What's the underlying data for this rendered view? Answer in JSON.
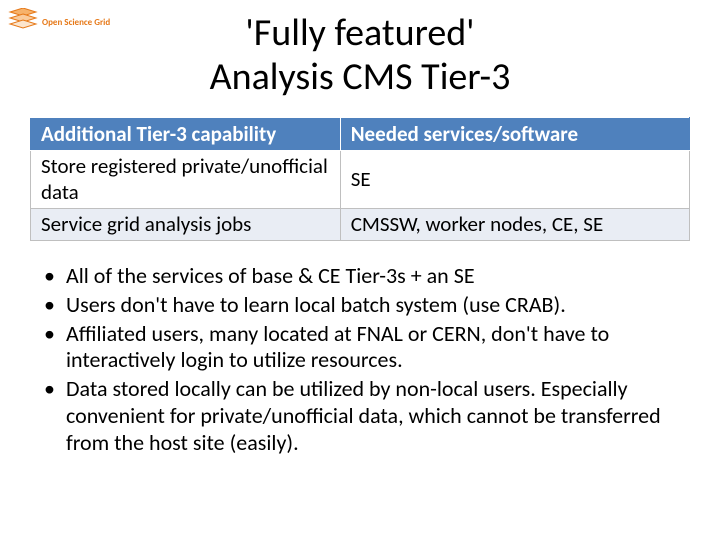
{
  "logo": {
    "text": "Open Science Grid"
  },
  "title": {
    "line1": "'Fully featured'",
    "line2": "Analysis CMS Tier-3"
  },
  "table": {
    "headers": [
      "Additional Tier-3 capability",
      "Needed services/software"
    ],
    "rows": [
      {
        "c1": "Store registered private/unofficial data",
        "c2": "SE"
      },
      {
        "c1": "Service grid analysis jobs",
        "c2": "CMSSW, worker nodes, CE, SE"
      }
    ]
  },
  "bullets": [
    "All of the services of base & CE Tier-3s + an SE",
    "Users don't have to learn local batch system (use CRAB).",
    "Affiliated users, many located at FNAL or CERN, don't have to interactively login to utilize resources.",
    "Data stored locally can be utilized by non-local users. Especially convenient for private/unofficial data, which cannot be transferred from the host site (easily)."
  ]
}
